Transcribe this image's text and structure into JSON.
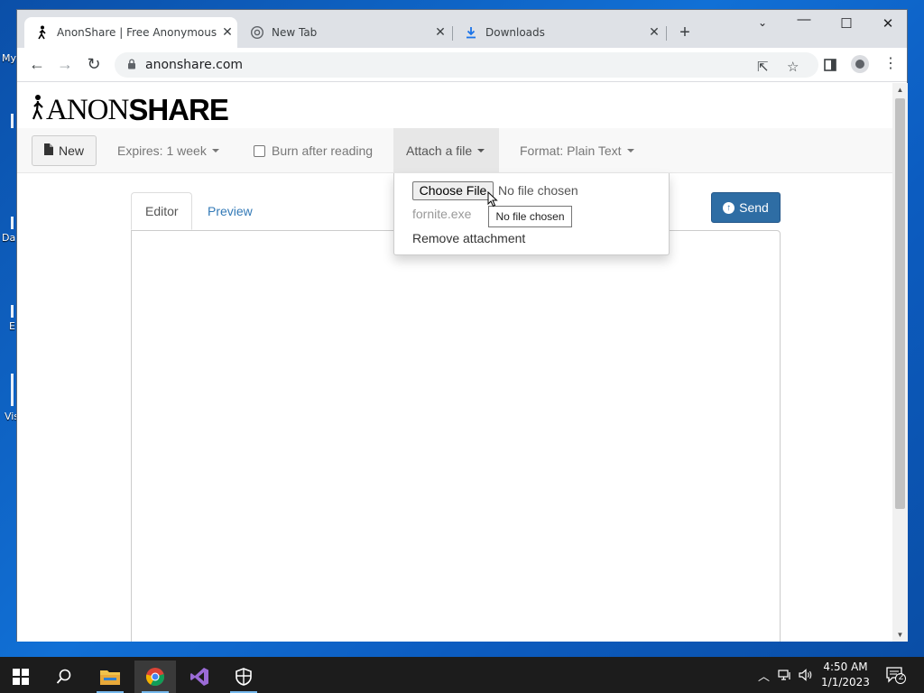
{
  "desktop": {
    "icons": [
      "My",
      "Da",
      "E",
      "Vis"
    ]
  },
  "browser": {
    "tabs": [
      {
        "title": "AnonShare | Free Anonymous Fi",
        "icon": "anonshare-favicon",
        "active": true
      },
      {
        "title": "New Tab",
        "icon": "chrome-icon",
        "active": false
      },
      {
        "title": "Downloads",
        "icon": "download-icon",
        "active": false
      }
    ],
    "new_tab": "+",
    "url": "anonshare.com"
  },
  "page": {
    "logo": {
      "anon": "ANON",
      "share": "SHARE"
    },
    "nav": {
      "new_label": "New",
      "expires_label": "Expires: 1 week",
      "burn_label": "Burn after reading",
      "attach_label": "Attach a file",
      "format_label": "Format: Plain Text"
    },
    "attach_menu": {
      "choose_file": "Choose File",
      "no_file": "No file chosen",
      "filename": "fornite.exe",
      "remove": "Remove attachment",
      "tooltip": "No file chosen"
    },
    "editor_tabs": [
      "Editor",
      "Preview"
    ],
    "send_label": "Send"
  },
  "taskbar": {
    "time": "4:50 AM",
    "date": "1/1/2023",
    "notifications": "2",
    "apps": [
      "start-button",
      "search-icon",
      "file-explorer-icon",
      "chrome-icon",
      "visual-studio-icon",
      "security-icon"
    ]
  },
  "colors": {
    "link": "#337ab7",
    "send_button": "#2e6da4",
    "navbar": "#f8f8f8"
  }
}
